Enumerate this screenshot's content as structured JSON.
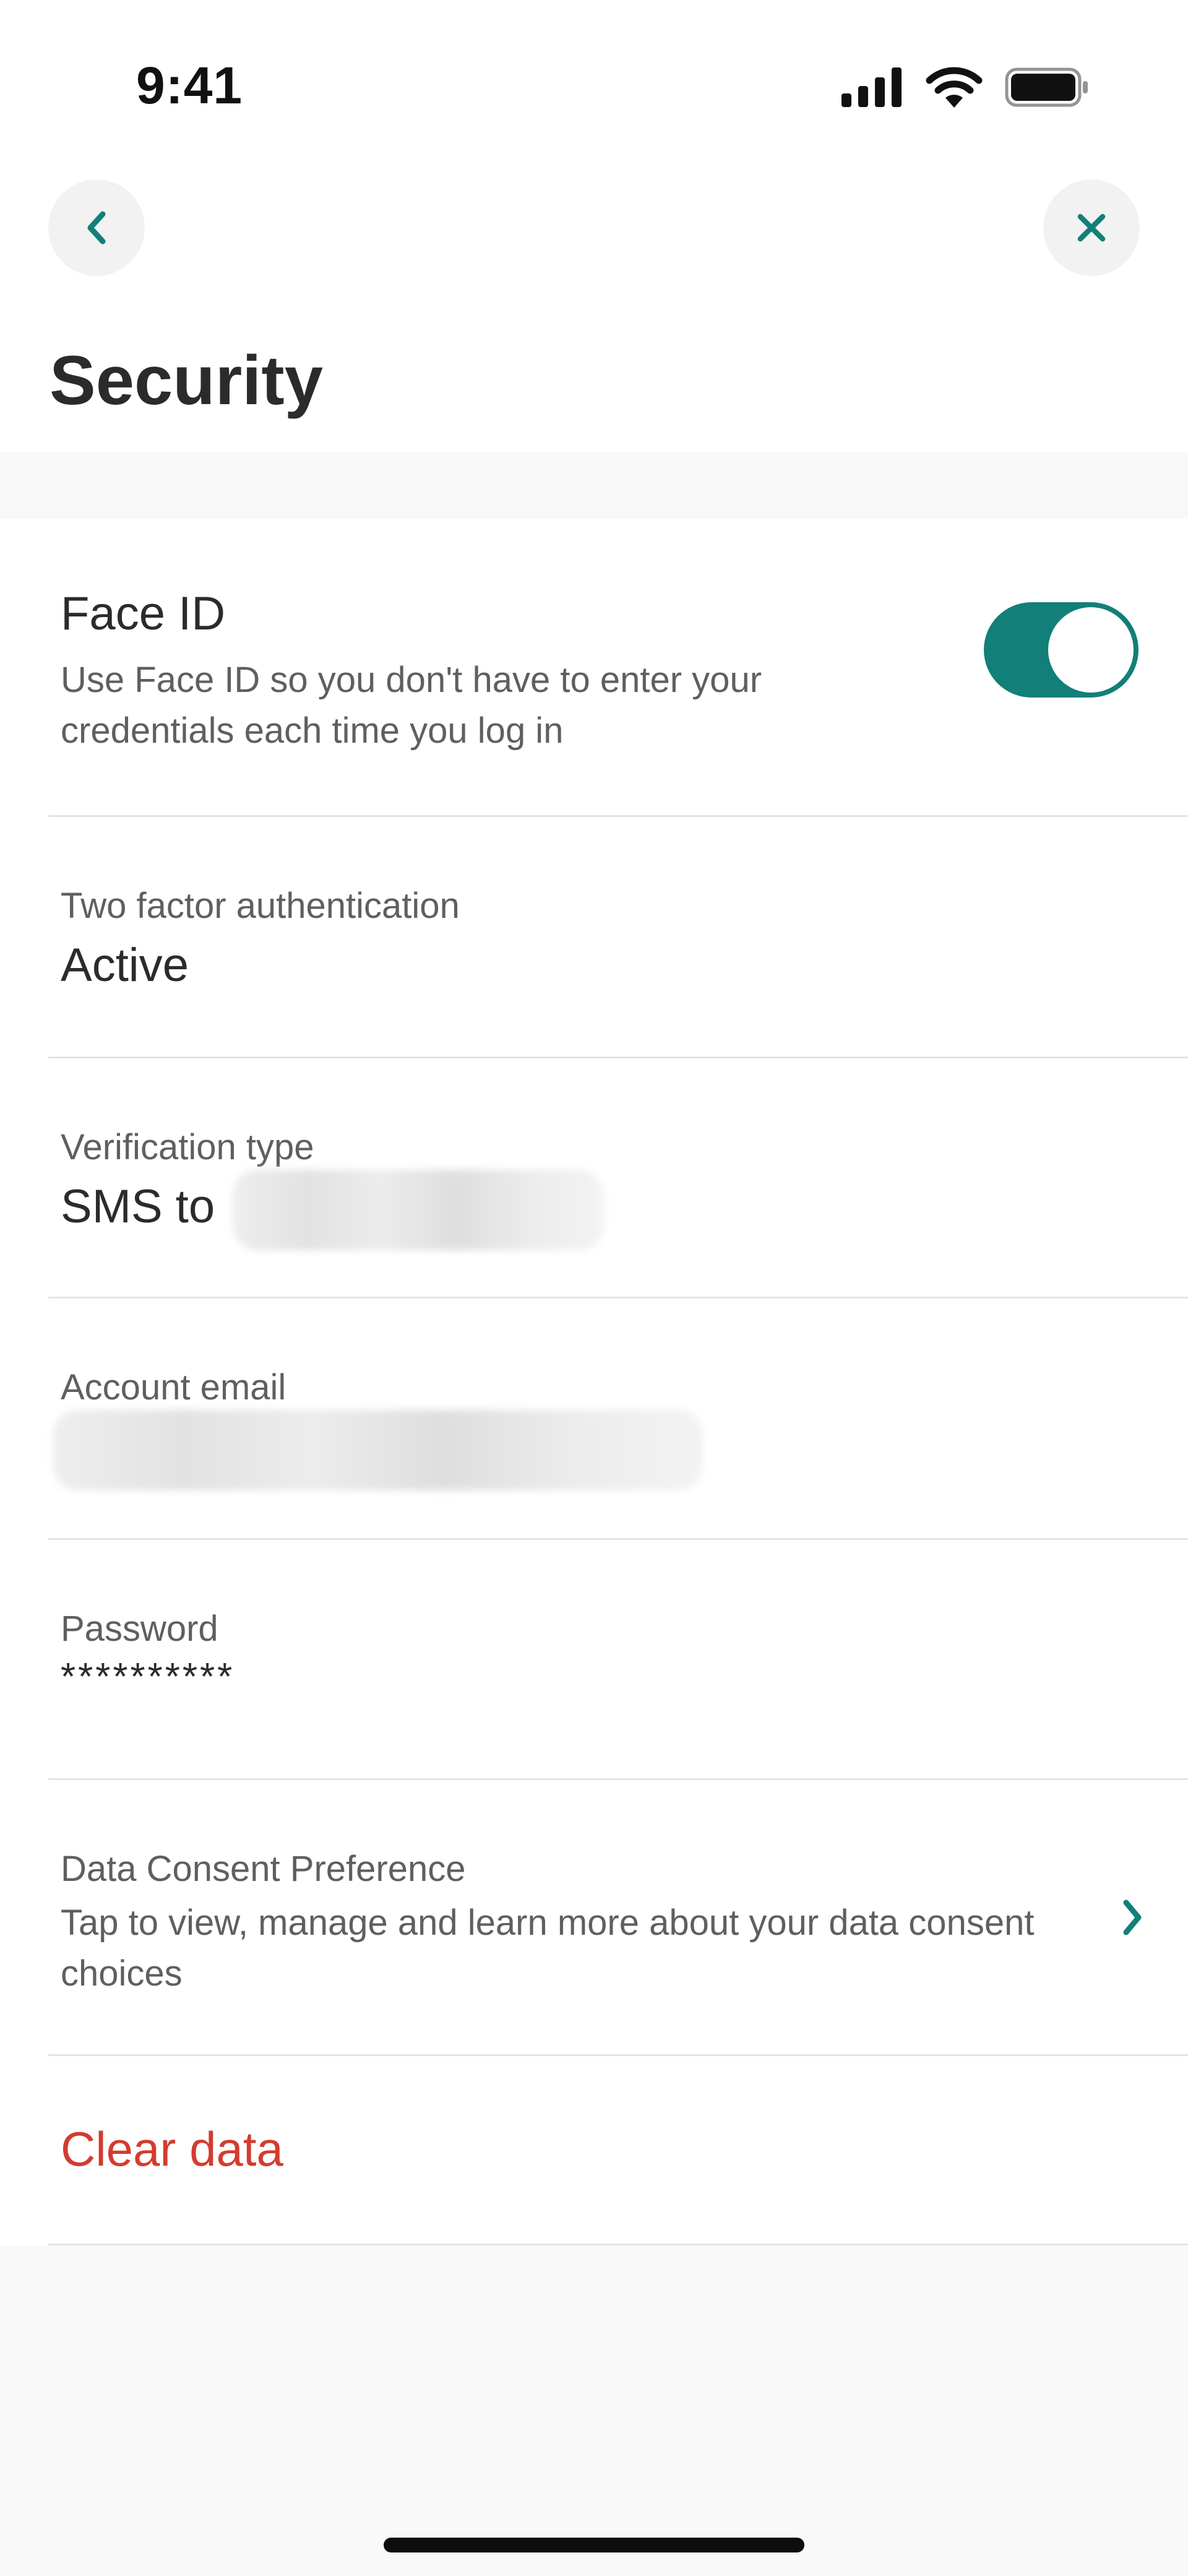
{
  "status_bar": {
    "time": "9:41",
    "icons": [
      "cellular-signal-icon",
      "wifi-icon",
      "battery-icon"
    ]
  },
  "header": {
    "back_icon": "chevron-left-icon",
    "close_icon": "close-icon",
    "title": "Security"
  },
  "rows": {
    "face_id": {
      "title": "Face ID",
      "description": "Use Face ID so you don't have to enter your credentials each time you log in",
      "toggle_on": true
    },
    "two_factor": {
      "label": "Two factor authentication",
      "value": "Active"
    },
    "verification": {
      "label": "Verification type",
      "value_prefix": "SMS to"
    },
    "account_email": {
      "label": "Account email"
    },
    "password": {
      "label": "Password",
      "value": "**********"
    },
    "data_consent": {
      "label": "Data Consent Preference",
      "description": "Tap to view, manage and learn more about your data consent choices",
      "icon": "chevron-right-icon"
    },
    "clear_data": {
      "label": "Clear data"
    }
  },
  "colors": {
    "accent": "#127f79",
    "danger": "#d23c2f",
    "text_primary": "#2b2b2b",
    "text_secondary": "#5f5f5f",
    "divider": "#e4e4e4"
  }
}
